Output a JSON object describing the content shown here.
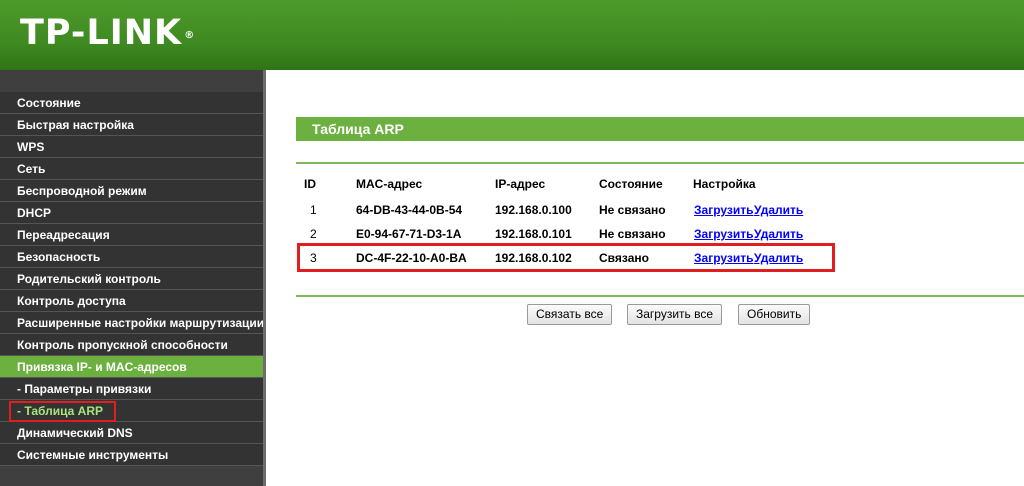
{
  "brand": {
    "logo": "TP-LINK",
    "reg": "®"
  },
  "sidebar": {
    "items": [
      {
        "label": "Состояние"
      },
      {
        "label": "Быстрая настройка"
      },
      {
        "label": "WPS"
      },
      {
        "label": "Сеть"
      },
      {
        "label": "Беспроводной режим"
      },
      {
        "label": "DHCP"
      },
      {
        "label": "Переадресация"
      },
      {
        "label": "Безопасность"
      },
      {
        "label": "Родительский контроль"
      },
      {
        "label": "Контроль доступа"
      },
      {
        "label": "Расширенные настройки маршрутизации"
      },
      {
        "label": "Контроль пропускной способности"
      },
      {
        "label": "Привязка IP- и MAC-адресов"
      },
      {
        "label": "- Параметры привязки"
      },
      {
        "label": "- Таблица ARP"
      },
      {
        "label": "Динамический DNS"
      },
      {
        "label": "Системные инструменты"
      }
    ]
  },
  "main": {
    "title": "Таблица ARP",
    "table": {
      "headers": [
        "ID",
        "MAC-адрес",
        "IP-адрес",
        "Состояние",
        "Настройка"
      ],
      "rows": [
        {
          "id": "1",
          "mac": "64-DB-43-44-0B-54",
          "ip": "192.168.0.100",
          "state": "Не связано",
          "load": "Загрузить",
          "delete": "Удалить"
        },
        {
          "id": "2",
          "mac": "E0-94-67-71-D3-1A",
          "ip": "192.168.0.101",
          "state": "Не связано",
          "load": "Загрузить",
          "delete": "Удалить"
        },
        {
          "id": "3",
          "mac": "DC-4F-22-10-A0-BA",
          "ip": "192.168.0.102",
          "state": "Связано",
          "load": "Загрузить",
          "delete": "Удалить"
        }
      ]
    },
    "buttons": {
      "bind_all": "Связать все",
      "load_all": "Загрузить все",
      "refresh": "Обновить"
    }
  },
  "colors": {
    "brand_green": "#4e9b2c",
    "accent_green": "#6cb13f",
    "highlight_red": "#e21d1d",
    "link_blue": "#0000ff"
  }
}
